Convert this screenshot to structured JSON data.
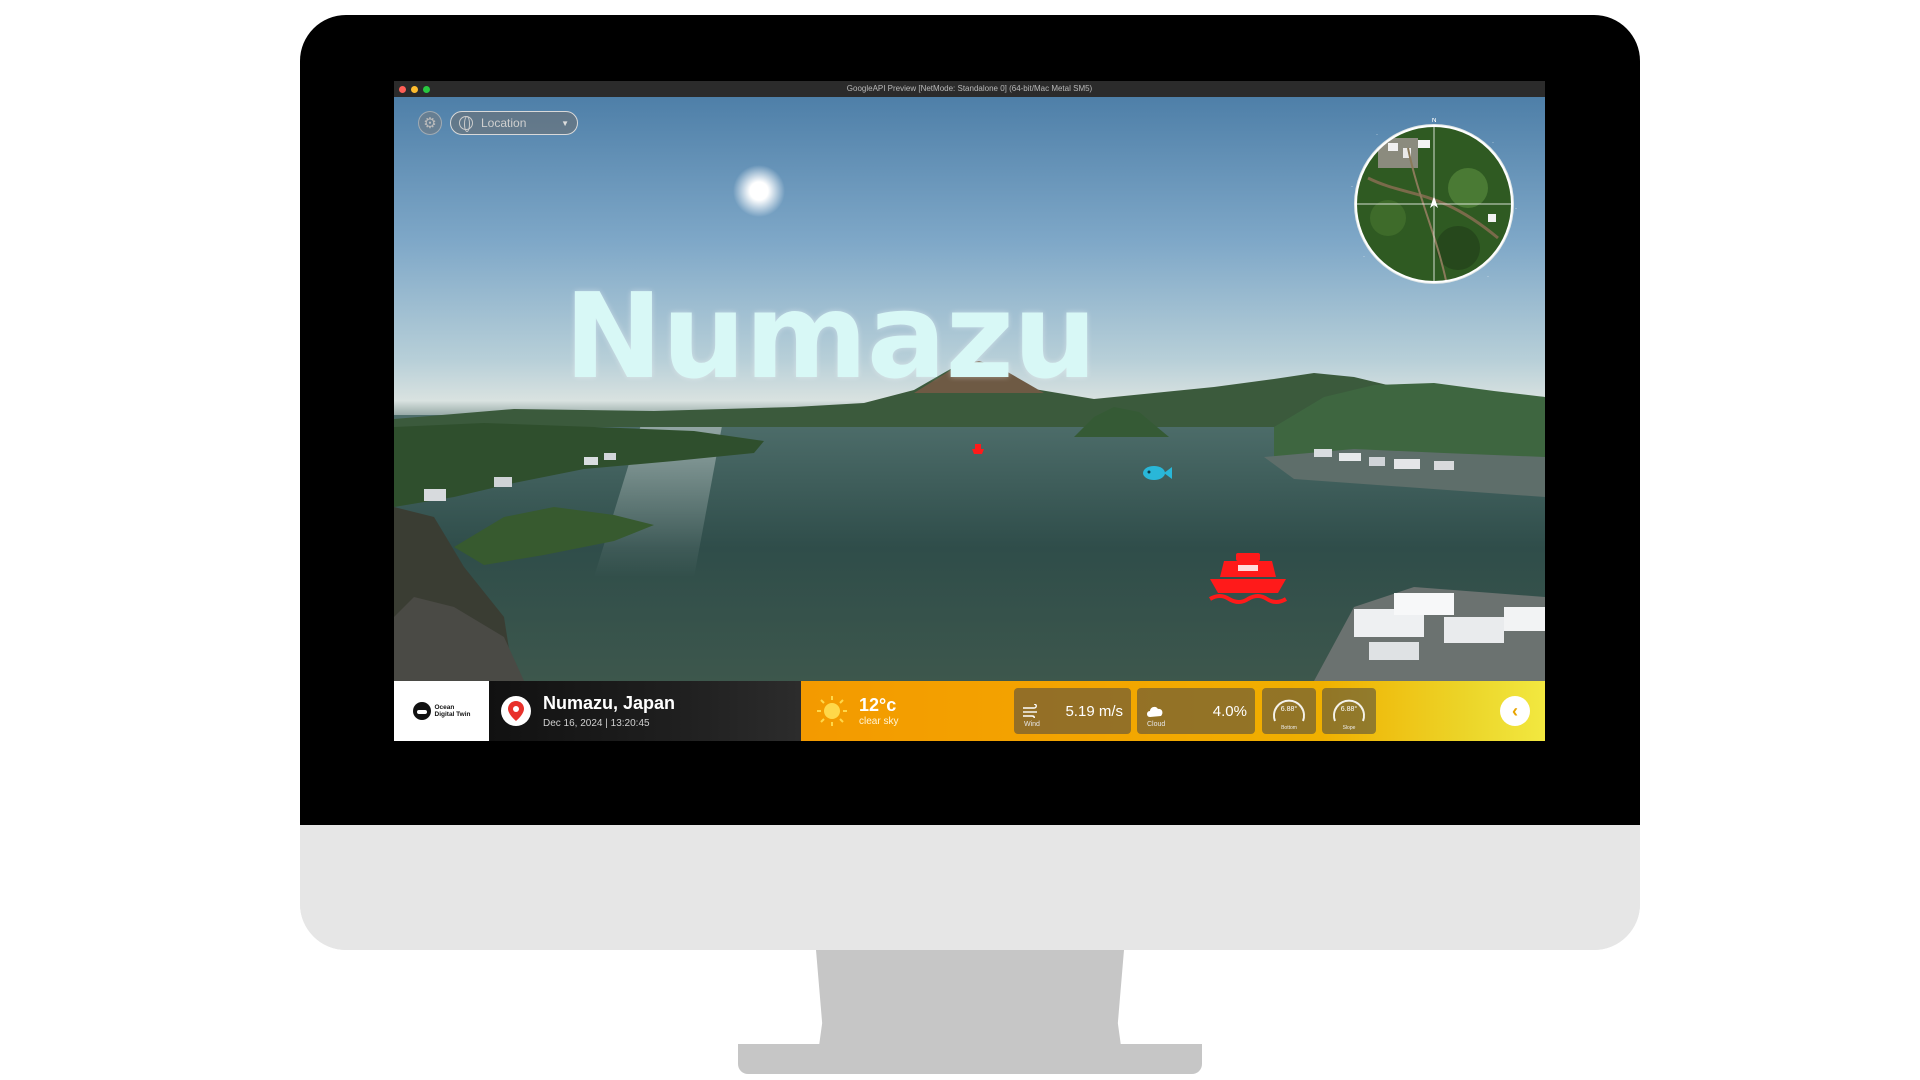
{
  "window": {
    "title": "GoogleAPI Preview [NetMode: Standalone 0]  (64-bit/Mac Metal SM5)"
  },
  "scene": {
    "city_label": "Numazu",
    "markers": [
      "boat-icon",
      "fish-icon",
      "boat-icon"
    ]
  },
  "toolbar": {
    "settings_icon": "gear-icon",
    "location_placeholder": "Location",
    "location_icon": "globe-icon",
    "dropdown_icon": "caret-down-icon"
  },
  "minimap": {
    "compass_icon": "compass-icon",
    "north_marker": "N"
  },
  "hud": {
    "logo": {
      "line1": "Ocean",
      "line2": "Digital Twin"
    },
    "location": {
      "name": "Numazu, Japan",
      "datetime": "Dec 16, 2024 | 13:20:45",
      "icon": "map-pin-icon"
    },
    "weather": {
      "temperature": "12°c",
      "condition": "clear sky",
      "icon": "sun-icon",
      "wind_label": "Wind",
      "wind_value": "5.19 m/s",
      "cloud_label": "Cloud",
      "cloud_value": "4.0%",
      "gauge1_value": "6.88°",
      "gauge1_label": "Bottom",
      "gauge2_value": "6.88°",
      "gauge2_label": "Slope"
    },
    "collapse_icon": "chevron-left-icon"
  },
  "colors": {
    "accent_orange": "#f39a00",
    "accent_yellow": "#f2e840",
    "marker_red": "#ff1a1a",
    "marker_cyan": "#29b7d8",
    "city_label": "#d8f8f6"
  }
}
